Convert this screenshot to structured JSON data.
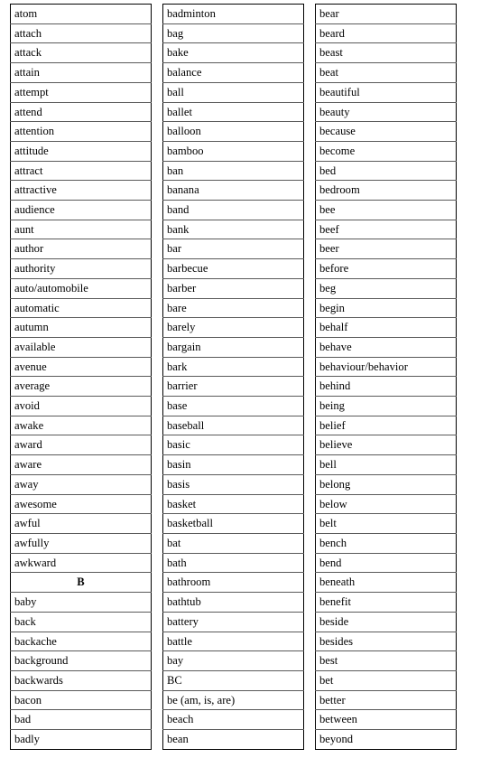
{
  "document": {
    "type": "word-list-table",
    "title": "",
    "section_letter": "B",
    "column_count": 3,
    "row_count_per_column": 38,
    "colors": {
      "text": "#000000",
      "cell_border": "#5a5a5a",
      "outer_border": "#000000",
      "background": "#ffffff"
    }
  },
  "columns": [
    {
      "name": "column-1",
      "cells": [
        {
          "text": "atom",
          "is_letter_heading": false
        },
        {
          "text": "attach",
          "is_letter_heading": false
        },
        {
          "text": "attack",
          "is_letter_heading": false
        },
        {
          "text": "attain",
          "is_letter_heading": false
        },
        {
          "text": "attempt",
          "is_letter_heading": false
        },
        {
          "text": "attend",
          "is_letter_heading": false
        },
        {
          "text": "attention",
          "is_letter_heading": false
        },
        {
          "text": "attitude",
          "is_letter_heading": false
        },
        {
          "text": "attract",
          "is_letter_heading": false
        },
        {
          "text": "attractive",
          "is_letter_heading": false
        },
        {
          "text": "audience",
          "is_letter_heading": false
        },
        {
          "text": "aunt",
          "is_letter_heading": false
        },
        {
          "text": "author",
          "is_letter_heading": false
        },
        {
          "text": "authority",
          "is_letter_heading": false
        },
        {
          "text": "auto/automobile",
          "is_letter_heading": false
        },
        {
          "text": "automatic",
          "is_letter_heading": false
        },
        {
          "text": "autumn",
          "is_letter_heading": false
        },
        {
          "text": "available",
          "is_letter_heading": false
        },
        {
          "text": "avenue",
          "is_letter_heading": false
        },
        {
          "text": "average",
          "is_letter_heading": false
        },
        {
          "text": "avoid",
          "is_letter_heading": false
        },
        {
          "text": "awake",
          "is_letter_heading": false
        },
        {
          "text": "award",
          "is_letter_heading": false
        },
        {
          "text": "aware",
          "is_letter_heading": false
        },
        {
          "text": "away",
          "is_letter_heading": false
        },
        {
          "text": "awesome",
          "is_letter_heading": false
        },
        {
          "text": "awful",
          "is_letter_heading": false
        },
        {
          "text": "awfully",
          "is_letter_heading": false
        },
        {
          "text": "awkward",
          "is_letter_heading": false
        },
        {
          "text": "B",
          "is_letter_heading": true
        },
        {
          "text": "baby",
          "is_letter_heading": false
        },
        {
          "text": "back",
          "is_letter_heading": false
        },
        {
          "text": "backache",
          "is_letter_heading": false
        },
        {
          "text": "background",
          "is_letter_heading": false
        },
        {
          "text": "backwards",
          "is_letter_heading": false
        },
        {
          "text": "bacon",
          "is_letter_heading": false
        },
        {
          "text": "bad",
          "is_letter_heading": false
        },
        {
          "text": "badly",
          "is_letter_heading": false
        }
      ]
    },
    {
      "name": "column-2",
      "cells": [
        {
          "text": "badminton",
          "is_letter_heading": false
        },
        {
          "text": "bag",
          "is_letter_heading": false
        },
        {
          "text": "bake",
          "is_letter_heading": false
        },
        {
          "text": "balance",
          "is_letter_heading": false
        },
        {
          "text": "ball",
          "is_letter_heading": false
        },
        {
          "text": "ballet",
          "is_letter_heading": false
        },
        {
          "text": "balloon",
          "is_letter_heading": false
        },
        {
          "text": "bamboo",
          "is_letter_heading": false
        },
        {
          "text": "ban",
          "is_letter_heading": false
        },
        {
          "text": "banana",
          "is_letter_heading": false
        },
        {
          "text": "band",
          "is_letter_heading": false
        },
        {
          "text": "bank",
          "is_letter_heading": false
        },
        {
          "text": "bar",
          "is_letter_heading": false
        },
        {
          "text": "barbecue",
          "is_letter_heading": false
        },
        {
          "text": "barber",
          "is_letter_heading": false
        },
        {
          "text": "bare",
          "is_letter_heading": false
        },
        {
          "text": "barely",
          "is_letter_heading": false
        },
        {
          "text": "bargain",
          "is_letter_heading": false
        },
        {
          "text": "bark",
          "is_letter_heading": false
        },
        {
          "text": "barrier",
          "is_letter_heading": false
        },
        {
          "text": "base",
          "is_letter_heading": false
        },
        {
          "text": "baseball",
          "is_letter_heading": false
        },
        {
          "text": "basic",
          "is_letter_heading": false
        },
        {
          "text": "basin",
          "is_letter_heading": false
        },
        {
          "text": "basis",
          "is_letter_heading": false
        },
        {
          "text": "basket",
          "is_letter_heading": false
        },
        {
          "text": "basketball",
          "is_letter_heading": false
        },
        {
          "text": "bat",
          "is_letter_heading": false
        },
        {
          "text": "bath",
          "is_letter_heading": false
        },
        {
          "text": "bathroom",
          "is_letter_heading": false
        },
        {
          "text": "bathtub",
          "is_letter_heading": false
        },
        {
          "text": "battery",
          "is_letter_heading": false
        },
        {
          "text": "battle",
          "is_letter_heading": false
        },
        {
          "text": "bay",
          "is_letter_heading": false
        },
        {
          "text": "BC",
          "is_letter_heading": false
        },
        {
          "text": "be (am, is, are)",
          "is_letter_heading": false
        },
        {
          "text": "beach",
          "is_letter_heading": false
        },
        {
          "text": "bean",
          "is_letter_heading": false
        }
      ]
    },
    {
      "name": "column-3",
      "cells": [
        {
          "text": "bear",
          "is_letter_heading": false
        },
        {
          "text": "beard",
          "is_letter_heading": false
        },
        {
          "text": "beast",
          "is_letter_heading": false
        },
        {
          "text": "beat",
          "is_letter_heading": false
        },
        {
          "text": "beautiful",
          "is_letter_heading": false
        },
        {
          "text": "beauty",
          "is_letter_heading": false
        },
        {
          "text": "because",
          "is_letter_heading": false
        },
        {
          "text": "become",
          "is_letter_heading": false
        },
        {
          "text": "bed",
          "is_letter_heading": false
        },
        {
          "text": "bedroom",
          "is_letter_heading": false
        },
        {
          "text": "bee",
          "is_letter_heading": false
        },
        {
          "text": "beef",
          "is_letter_heading": false
        },
        {
          "text": "beer",
          "is_letter_heading": false
        },
        {
          "text": "before",
          "is_letter_heading": false
        },
        {
          "text": "beg",
          "is_letter_heading": false
        },
        {
          "text": "begin",
          "is_letter_heading": false
        },
        {
          "text": "behalf",
          "is_letter_heading": false
        },
        {
          "text": "behave",
          "is_letter_heading": false
        },
        {
          "text": "behaviour/behavior",
          "is_letter_heading": false
        },
        {
          "text": "behind",
          "is_letter_heading": false
        },
        {
          "text": "being",
          "is_letter_heading": false
        },
        {
          "text": "belief",
          "is_letter_heading": false
        },
        {
          "text": "believe",
          "is_letter_heading": false
        },
        {
          "text": "bell",
          "is_letter_heading": false
        },
        {
          "text": "belong",
          "is_letter_heading": false
        },
        {
          "text": "below",
          "is_letter_heading": false
        },
        {
          "text": "belt",
          "is_letter_heading": false
        },
        {
          "text": "bench",
          "is_letter_heading": false
        },
        {
          "text": "bend",
          "is_letter_heading": false
        },
        {
          "text": "beneath",
          "is_letter_heading": false
        },
        {
          "text": "benefit",
          "is_letter_heading": false
        },
        {
          "text": "beside",
          "is_letter_heading": false
        },
        {
          "text": "besides",
          "is_letter_heading": false
        },
        {
          "text": "best",
          "is_letter_heading": false
        },
        {
          "text": "bet",
          "is_letter_heading": false
        },
        {
          "text": "better",
          "is_letter_heading": false
        },
        {
          "text": "between",
          "is_letter_heading": false
        },
        {
          "text": "beyond",
          "is_letter_heading": false
        }
      ]
    }
  ]
}
